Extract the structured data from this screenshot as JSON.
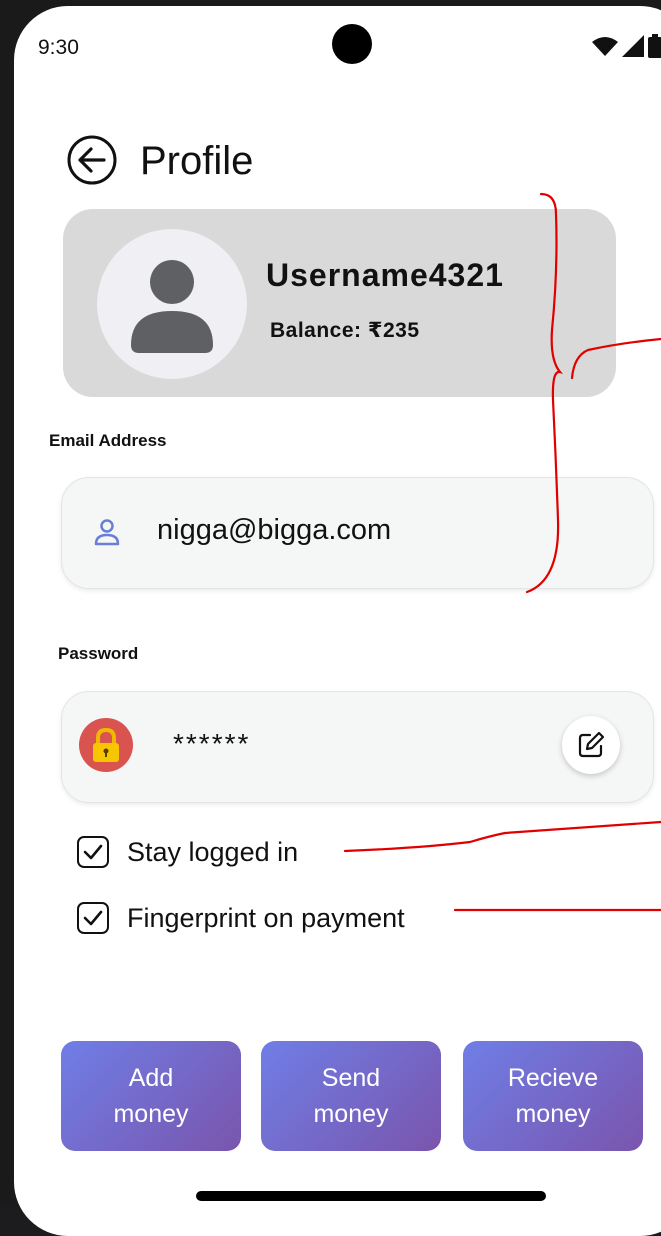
{
  "status_bar": {
    "time": "9:30"
  },
  "header": {
    "title": "Profile"
  },
  "profile": {
    "username": "Username4321",
    "balance": "Balance: ₹235"
  },
  "email": {
    "label": "Email Address",
    "value": "nigga@bigga.com"
  },
  "password": {
    "label": "Password",
    "value": "******"
  },
  "options": [
    {
      "label": "Stay logged in",
      "checked": true
    },
    {
      "label": "Fingerprint on payment",
      "checked": true
    }
  ],
  "actions": {
    "add": "Add money",
    "send": "Send money",
    "recieve": "Recieve money"
  },
  "colors": {
    "card_bg": "#d9d9d9",
    "button_gradient_start": "#6f7ee6",
    "button_gradient_end": "#7a55ad",
    "lock_bg": "#d9534f",
    "annotation": "#e00000"
  },
  "icons": [
    "wifi-icon",
    "signal-icon",
    "battery-icon",
    "back-arrow-icon",
    "person-icon",
    "user-outline-icon",
    "lock-icon",
    "edit-icon",
    "checkmark-icon"
  ]
}
